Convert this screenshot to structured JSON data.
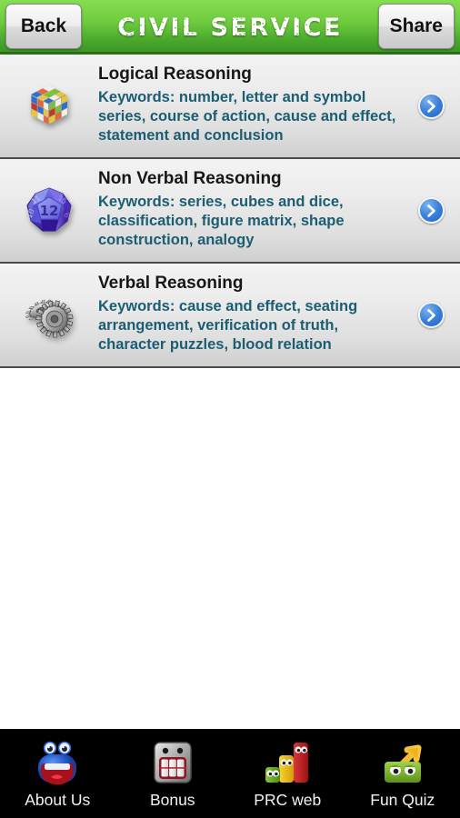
{
  "header": {
    "back_label": "Back",
    "title": "CIVIL SERVICE",
    "share_label": "Share",
    "bg_top_color": "#86dd52",
    "bg_bottom_color": "#3d9726",
    "title_color": "#ffffff"
  },
  "list": {
    "keyword_color": "#1b5d72",
    "title_color": "#171717",
    "items": [
      {
        "title": "Logical Reasoning",
        "keywords": "Keywords: number, letter and symbol series, course of action, cause and effect, statement and conclusion",
        "icon": "rubiks-cube-icon",
        "arrow": "chevron-right-icon"
      },
      {
        "title": "Non Verbal Reasoning",
        "keywords": "Keywords: series, cubes and dice, classification, figure matrix, shape construction, analogy",
        "icon": "polyhedral-die-icon",
        "die_face_value": "12",
        "die_side_values": [
          "11",
          "15",
          "10",
          "6"
        ],
        "arrow": "chevron-right-icon"
      },
      {
        "title": "Verbal Reasoning",
        "keywords": "Keywords: cause and effect, seating arrangement, verification of truth, character puzzles, blood relation",
        "icon": "gears-icon",
        "arrow": "chevron-right-icon"
      }
    ]
  },
  "tabbar": {
    "background_color": "#000000",
    "label_color": "#f2f2f2",
    "tabs": [
      {
        "label": "About Us",
        "icon": "blue-monster-icon"
      },
      {
        "label": "Bonus",
        "icon": "robot-face-icon"
      },
      {
        "label": "PRC web",
        "icon": "bar-chart-monsters-icon"
      },
      {
        "label": "Fun Quiz",
        "icon": "green-monster-arrow-icon"
      }
    ]
  }
}
